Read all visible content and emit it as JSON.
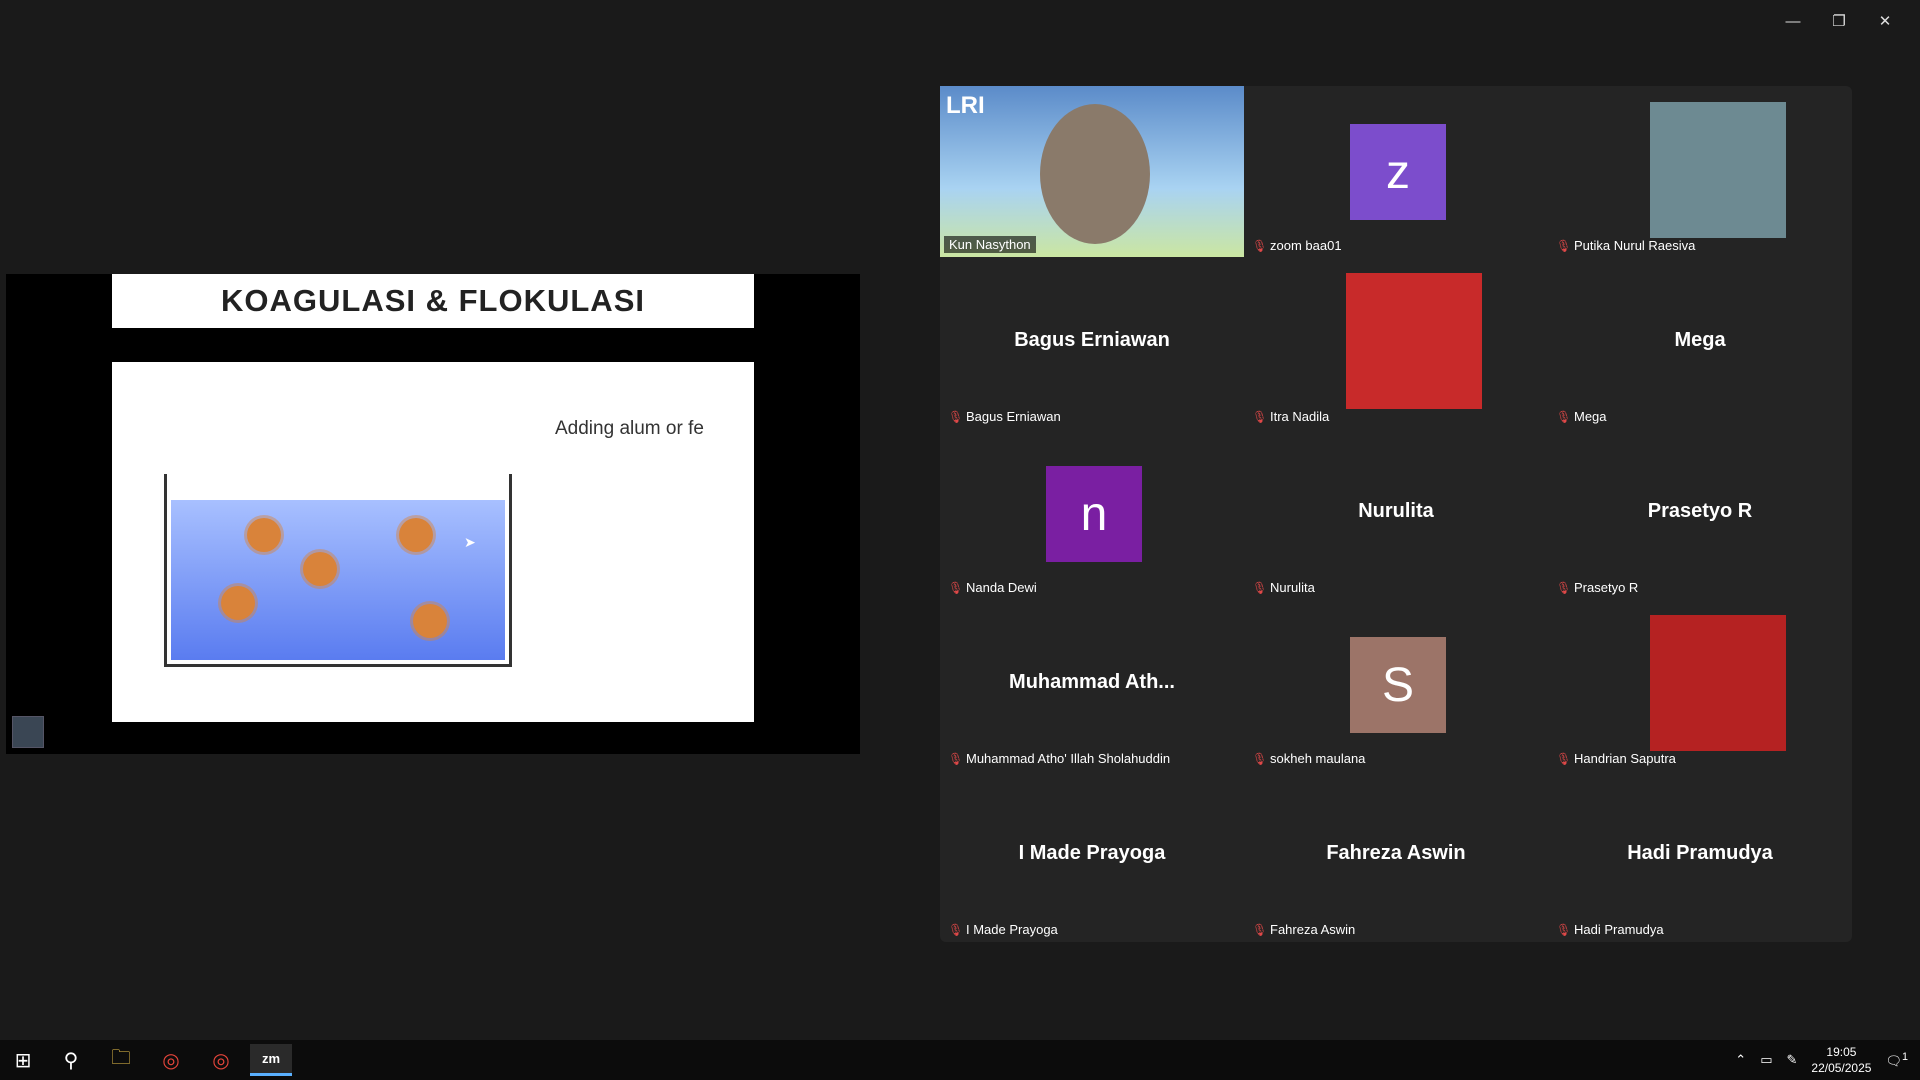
{
  "window": {
    "minimize": "—",
    "restore": "❐",
    "close": "✕"
  },
  "slide": {
    "title": "KOAGULASI & FLOKULASI",
    "caption": "Adding alum or fe"
  },
  "participants": [
    {
      "name": "Kun Nasython",
      "display": "video",
      "active": true
    },
    {
      "name": "zoom baa01",
      "display": "avatar",
      "initial": "z",
      "color": "#7c4dcc"
    },
    {
      "name": "Putika Nurul Raesiva",
      "display": "photo",
      "photo_color": "#6d8a92"
    },
    {
      "name": "Bagus Erniawan",
      "display": "text",
      "big": "Bagus Erniawan"
    },
    {
      "name": "Itra Nadila",
      "display": "photo",
      "photo_color": "#c82a2a"
    },
    {
      "name": "Mega",
      "display": "text",
      "big": "Mega"
    },
    {
      "name": "Nanda Dewi",
      "display": "avatar",
      "initial": "n",
      "color": "#7a1fa2"
    },
    {
      "name": "Nurulita",
      "display": "text",
      "big": "Nurulita"
    },
    {
      "name": "Prasetyo R",
      "display": "text",
      "big": "Prasetyo R"
    },
    {
      "name": "Muhammad Atho' Illah Sholahuddin",
      "display": "text",
      "big": "Muhammad  Ath..."
    },
    {
      "name": "sokheh maulana",
      "display": "avatar",
      "initial": "S",
      "color": "#9c7468"
    },
    {
      "name": "Handrian Saputra",
      "display": "photo",
      "photo_color": "#b52222"
    },
    {
      "name": "I Made Prayoga",
      "display": "text",
      "big": "I Made Prayoga"
    },
    {
      "name": "Fahreza Aswin",
      "display": "text",
      "big": "Fahreza Aswin"
    },
    {
      "name": "Hadi Pramudya",
      "display": "text",
      "big": "Hadi Pramudya"
    }
  ],
  "video_badge": "LRI",
  "taskbar": {
    "start": "⊞",
    "search": "⚲",
    "files": "🗀",
    "chrome1": "◎",
    "chrome2": "◎",
    "zoom": "zm",
    "time": "19:05",
    "date": "22/05/2025",
    "notifications": "1"
  }
}
